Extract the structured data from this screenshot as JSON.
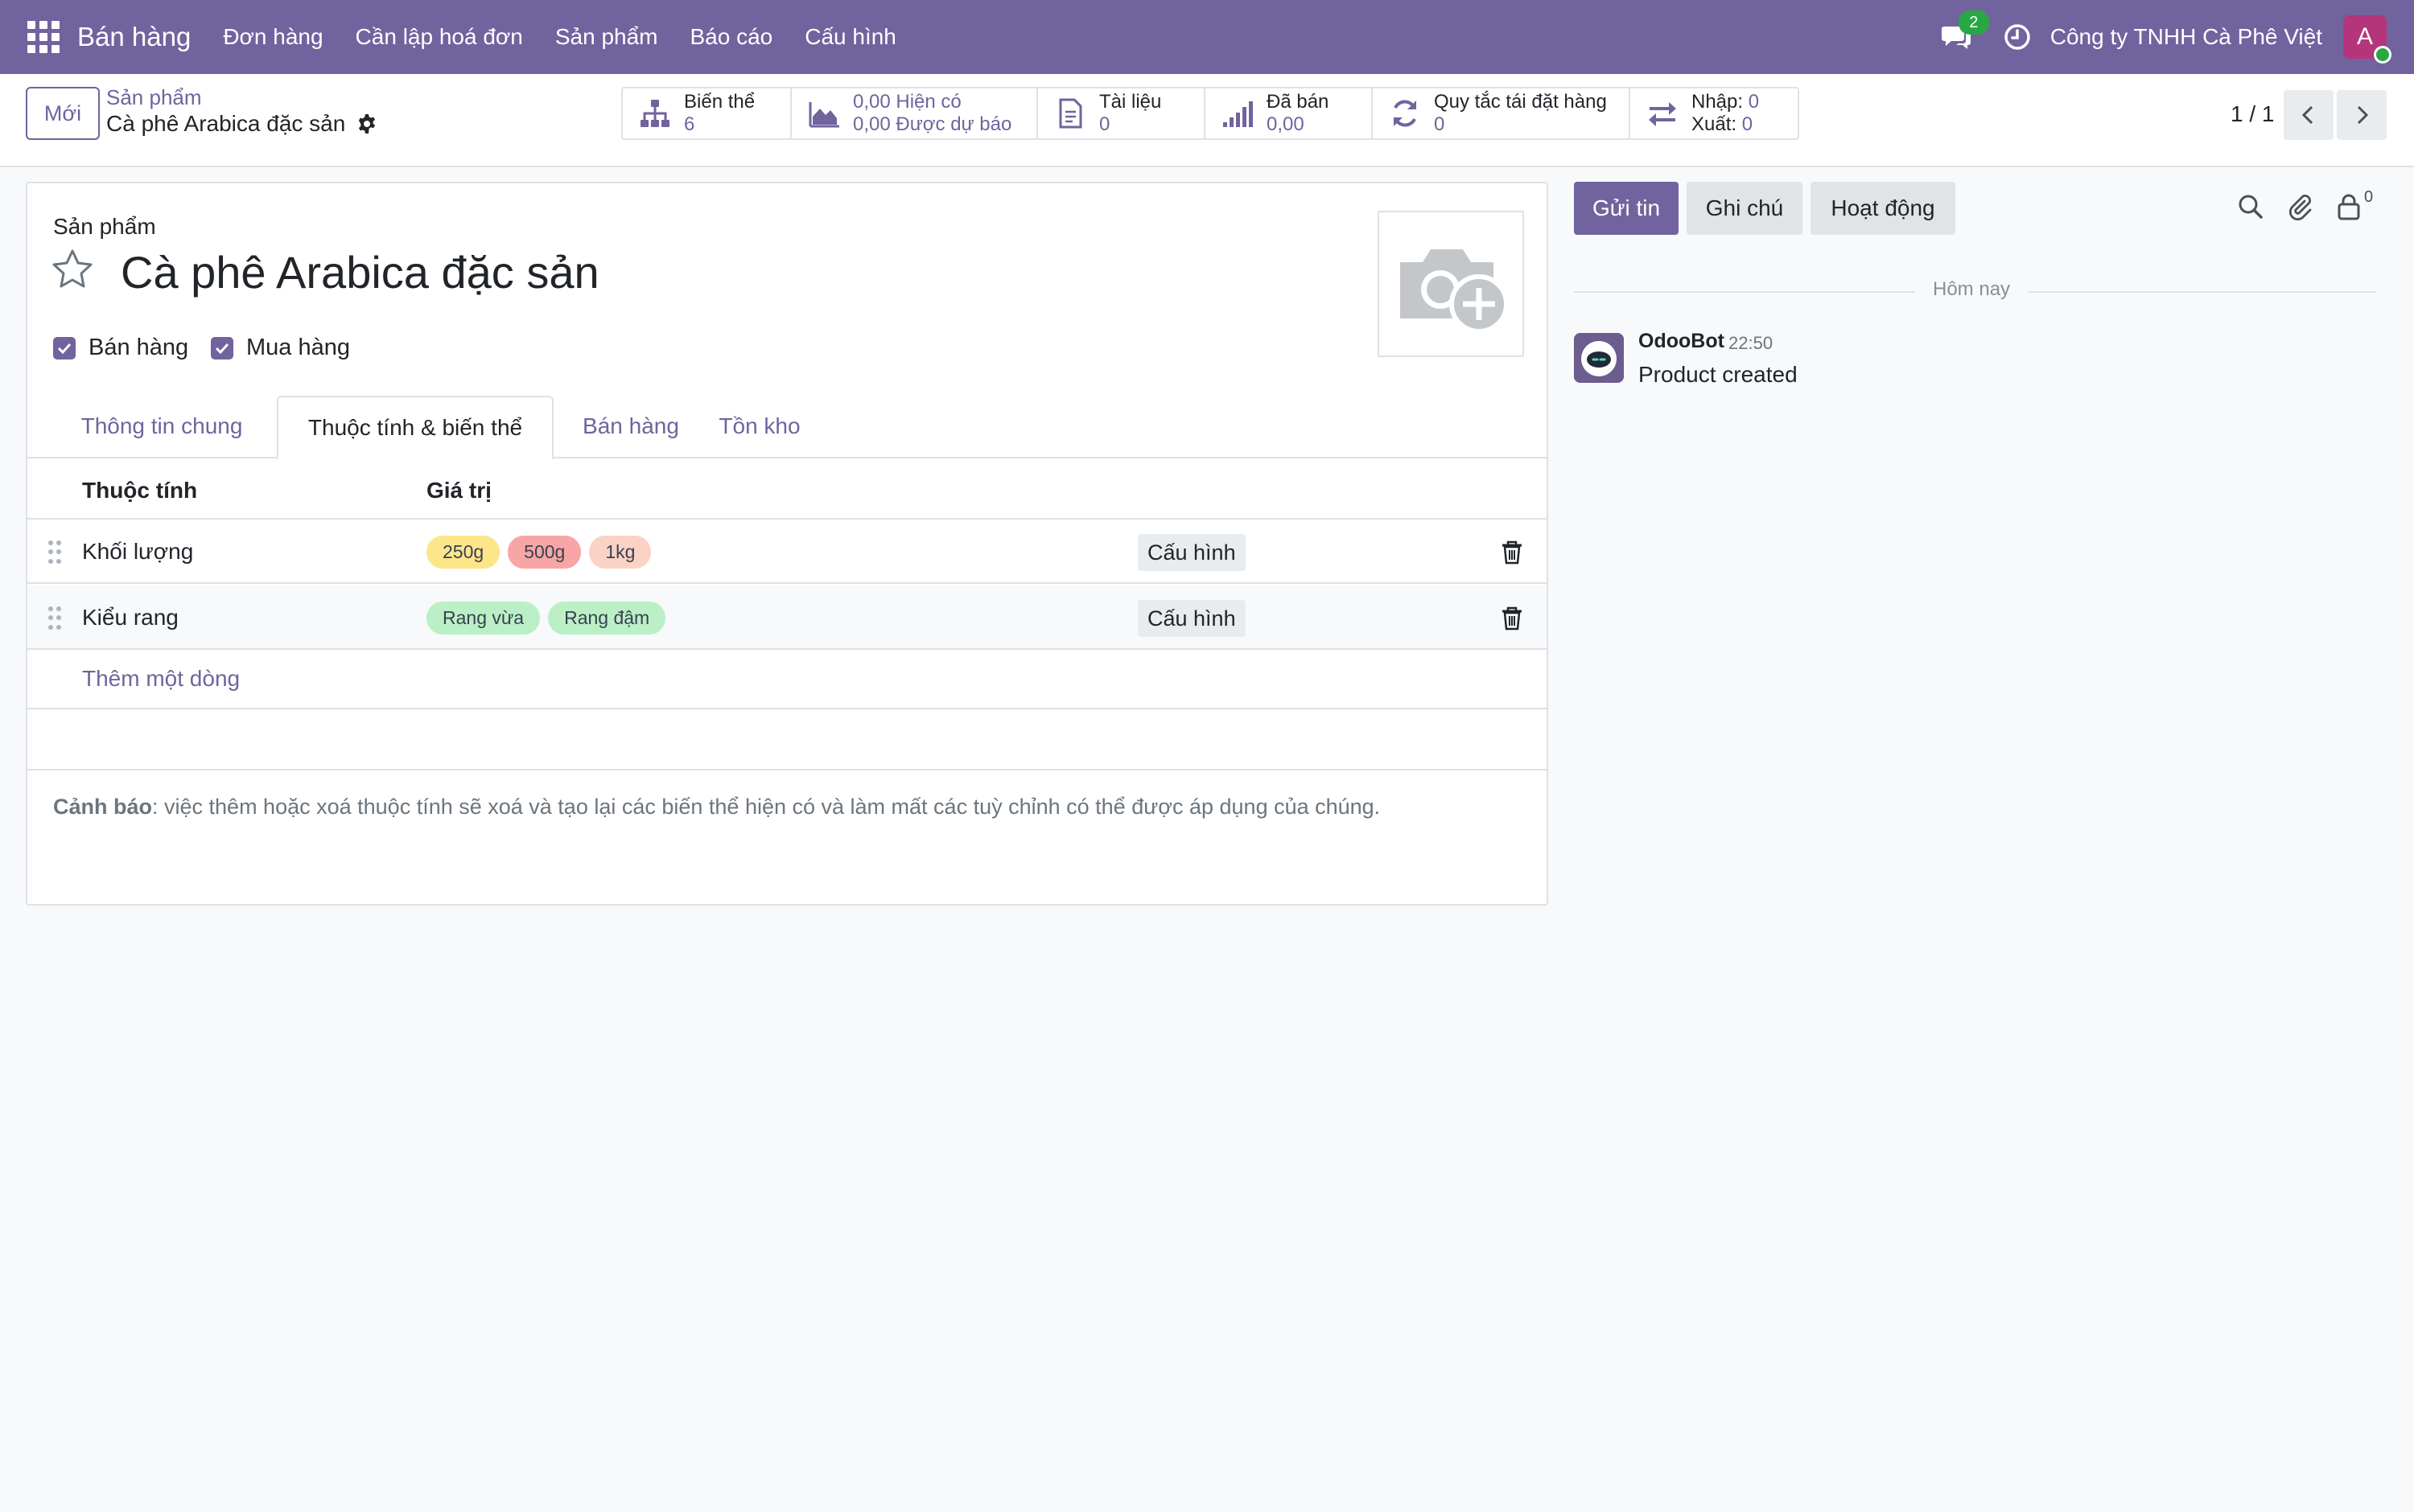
{
  "navbar": {
    "brand": "Bán hàng",
    "menu": [
      "Đơn hàng",
      "Cần lập hoá đơn",
      "Sản phẩm",
      "Báo cáo",
      "Cấu hình"
    ],
    "messages_count": "2",
    "company": "Công ty TNHH Cà Phê Việt",
    "user_initial": "A"
  },
  "control": {
    "new_label": "Mới",
    "breadcrumb_parent": "Sản phẩm",
    "breadcrumb_current": "Cà phê Arabica đặc sản",
    "smart_buttons": {
      "variants_label": "Biến thể",
      "variants_value": "6",
      "onhand_value": "0,00",
      "onhand_label": "Hiện có",
      "forecast_value": "0,00",
      "forecast_label": "Được dự báo",
      "docs_label": "Tài liệu",
      "docs_value": "0",
      "sold_label": "Đã bán",
      "sold_value": "0,00",
      "reorder_label": "Quy tắc tái đặt hàng",
      "reorder_value": "0",
      "in_label": "Nhập:",
      "in_value": "0",
      "out_label": "Xuất:",
      "out_value": "0"
    },
    "pager": "1 / 1"
  },
  "form": {
    "label": "Sản phẩm",
    "name": "Cà phê Arabica đặc sản",
    "checkboxes": [
      {
        "label": "Bán hàng",
        "checked": true
      },
      {
        "label": "Mua hàng",
        "checked": true
      }
    ],
    "tabs": [
      "Thông tin chung",
      "Thuộc tính & biến thể",
      "Bán hàng",
      "Tồn kho"
    ],
    "active_tab": "Thuộc tính & biến thể",
    "columns": [
      "Thuộc tính",
      "Giá trị"
    ],
    "rows": [
      {
        "attribute": "Khối lượng",
        "values": [
          {
            "label": "250g",
            "color": "#fde68a"
          },
          {
            "label": "500g",
            "color": "#f8a5a5"
          },
          {
            "label": "1kg",
            "color": "#fbd3c4"
          }
        ],
        "button": "Cấu hình"
      },
      {
        "attribute": "Kiểu rang",
        "values": [
          {
            "label": "Rang vừa",
            "color": "#bbf0c6"
          },
          {
            "label": "Rang đậm",
            "color": "#bbf0c6"
          }
        ],
        "button": "Cấu hình"
      }
    ],
    "add_line": "Thêm một dòng",
    "warning_bold": "Cảnh báo",
    "warning_text": ": việc thêm hoặc xoá thuộc tính sẽ xoá và tạo lại các biến thể hiện có và làm mất các tuỳ chỉnh có thể được áp dụng của chúng."
  },
  "chatter": {
    "send_label": "Gửi tin",
    "note_label": "Ghi chú",
    "activity_label": "Hoạt động",
    "followers_count": "0",
    "day_label": "Hôm nay",
    "author": "OdooBot",
    "time": "22:50",
    "message": "Product created"
  },
  "colors": {
    "primary": "#71639e",
    "navbar": "#71639e",
    "success": "#28a745"
  }
}
